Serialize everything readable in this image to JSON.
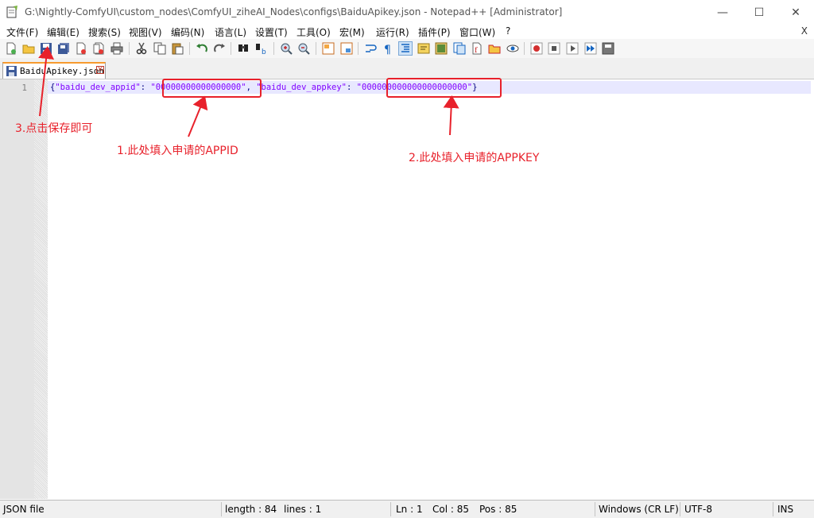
{
  "window": {
    "title": "G:\\Nightly-ComfyUI\\custom_nodes\\ComfyUI_ziheAI_Nodes\\configs\\BaiduApikey.json - Notepad++ [Administrator]",
    "minimize_glyph": "—",
    "maximize_glyph": "☐",
    "close_glyph": "✕"
  },
  "menu": {
    "items": [
      "文件(F)",
      "编辑(E)",
      "搜索(S)",
      "视图(V)",
      "编码(N)",
      "语言(L)",
      "设置(T)",
      "工具(O)",
      "宏(M)",
      "运行(R)",
      "插件(P)",
      "窗口(W)",
      "?"
    ],
    "close_label": "X"
  },
  "tab": {
    "label": "BaiduApikey.json",
    "close_glyph": "✕"
  },
  "editor": {
    "line_number": "1",
    "code": {
      "open_brace": "{",
      "key1": "\"baidu_dev_appid\"",
      "colon1": ": ",
      "value1": "\"00000000000000000\"",
      "comma": ", ",
      "key2": "\"baidu_dev_appkey\"",
      "colon2": ": ",
      "value2": "\"000000000000000000000\"",
      "close_brace": "}"
    }
  },
  "annotations": {
    "save_hint": "3.点击保存即可",
    "appid_hint": "1.此处填入申请的APPID",
    "appkey_hint": "2.此处填入申请的APPKEY",
    "color": "#e8212b"
  },
  "status": {
    "file_type": "JSON file",
    "length": "length : 84",
    "lines": "lines : 1",
    "ln": "Ln : 1",
    "col": "Col : 85",
    "pos": "Pos : 85",
    "eol": "Windows (CR LF)",
    "encoding": "UTF-8",
    "mode": "INS"
  }
}
